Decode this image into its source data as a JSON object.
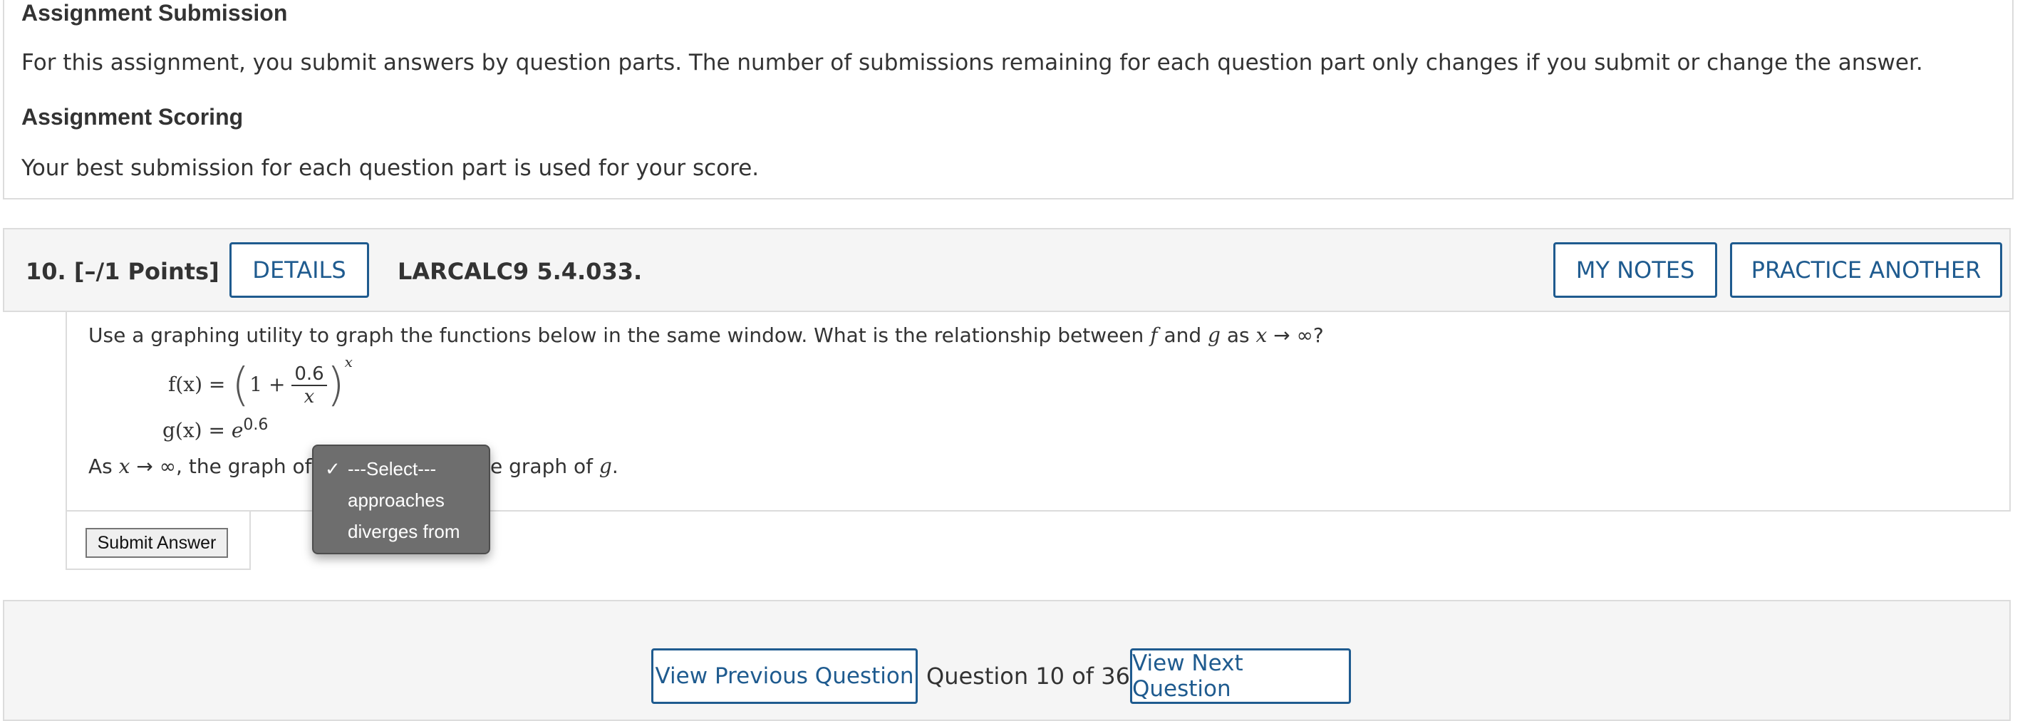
{
  "submission": {
    "title": "Assignment Submission",
    "text": "For this assignment, you submit answers by question parts. The number of submissions remaining for each question part only changes if you submit or change the answer."
  },
  "scoring": {
    "title": "Assignment Scoring",
    "text": "Your best submission for each question part is used for your score."
  },
  "question": {
    "number": "10.",
    "points": "[–/1 Points]",
    "details_label": "DETAILS",
    "reference": "LARCALC9 5.4.033.",
    "my_notes_label": "MY NOTES",
    "practice_label": "PRACTICE ANOTHER",
    "prompt_start": "Use a graphing utility to graph the functions below in the same window. What is the relationship between ",
    "prompt_f": "f",
    "prompt_and": " and ",
    "prompt_g": "g",
    "prompt_as": " as ",
    "prompt_x": "x",
    "prompt_end": " → ∞?",
    "f_lhs": "f(x) = ",
    "f_one_plus": "1 + ",
    "f_num": "0.6",
    "f_den": "x",
    "f_exp": "x",
    "g_lhs": "g(x) = ",
    "g_base": "e",
    "g_exp": "0.6",
    "sentence_start": "As ",
    "sentence_x": "x",
    "sentence_mid": " → ∞, the graph of ",
    "sentence_end_pre": "e graph of ",
    "sentence_g": "g",
    "sentence_period": "."
  },
  "dropdown": {
    "options": [
      {
        "label": "---Select---",
        "checked": true
      },
      {
        "label": "approaches",
        "checked": false
      },
      {
        "label": "diverges from",
        "checked": false
      }
    ],
    "check_mark": "✓"
  },
  "submit_label": "Submit Answer",
  "navigation": {
    "prev_label": "View Previous Question",
    "position_text": "Question 10 of 36",
    "next_label": "View Next Question"
  },
  "colors": {
    "link_blue": "#1f5b8f",
    "panel_gray": "#f5f5f5",
    "dropdown_bg": "#6e6e6e"
  }
}
